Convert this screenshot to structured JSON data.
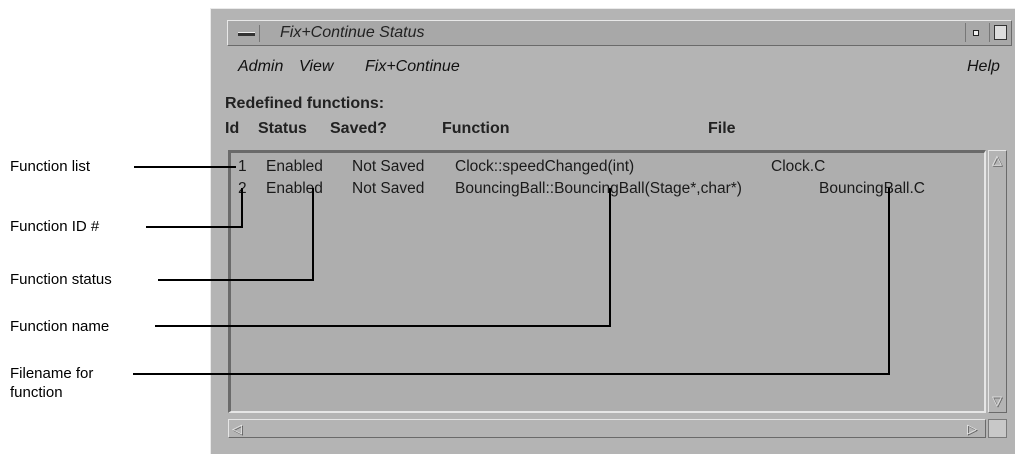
{
  "window": {
    "title": "Fix+Continue Status"
  },
  "menu": {
    "admin": "Admin",
    "view": "View",
    "fixcontinue": "Fix+Continue",
    "help": "Help"
  },
  "section_label": "Redefined functions:",
  "columns": {
    "id": "Id",
    "status": "Status",
    "saved": "Saved?",
    "function": "Function",
    "file": "File"
  },
  "rows": [
    {
      "id": "1",
      "status": "Enabled",
      "saved": "Not Saved",
      "function": "Clock::speedChanged(int)",
      "file": "Clock.C"
    },
    {
      "id": "2",
      "status": "Enabled",
      "saved": "Not Saved",
      "function": "BouncingBall::BouncingBall(Stage*,char*)",
      "file": "BouncingBall.C"
    }
  ],
  "callouts": {
    "function_list": "Function list",
    "function_id": "Function ID #",
    "function_status": "Function status",
    "function_name": "Function name",
    "filename_line1": "Filename for",
    "filename_line2": "function"
  }
}
